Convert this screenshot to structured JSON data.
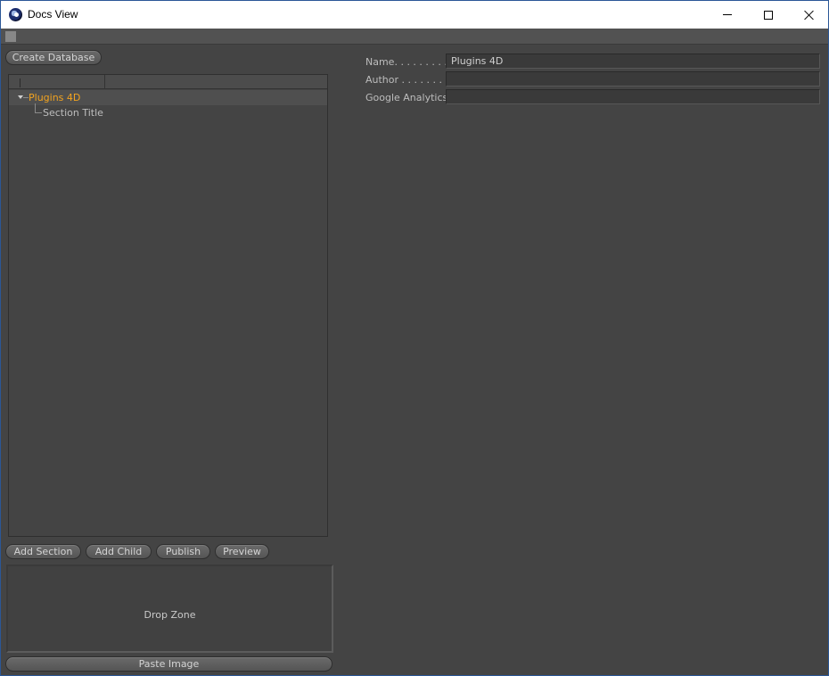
{
  "window": {
    "title": "Docs View"
  },
  "toolbar": {
    "create_database_label": "Create Database"
  },
  "tree": {
    "root": {
      "label": "Plugins 4D",
      "expanded": true
    },
    "children": [
      {
        "label": "Section Title"
      }
    ]
  },
  "actions": {
    "add_section_label": "Add Section",
    "add_child_label": "Add Child",
    "publish_label": "Publish",
    "preview_label": "Preview"
  },
  "drop_zone": {
    "label": "Drop Zone"
  },
  "paste_image_label": "Paste Image",
  "properties": {
    "name": {
      "label": "Name. . . . . . . . . .",
      "value": "Plugins 4D"
    },
    "author": {
      "label": "Author . . . . . . . .",
      "value": ""
    },
    "google_analytics": {
      "label": "Google Analytics",
      "value": ""
    }
  },
  "colors": {
    "background": "#444444",
    "selected_text": "#f2a31f",
    "text": "#cfcfcf"
  },
  "icons": {
    "app": "cinema4d-logo-icon",
    "grip": "grip-icon",
    "expand": "triangle-down-icon"
  }
}
